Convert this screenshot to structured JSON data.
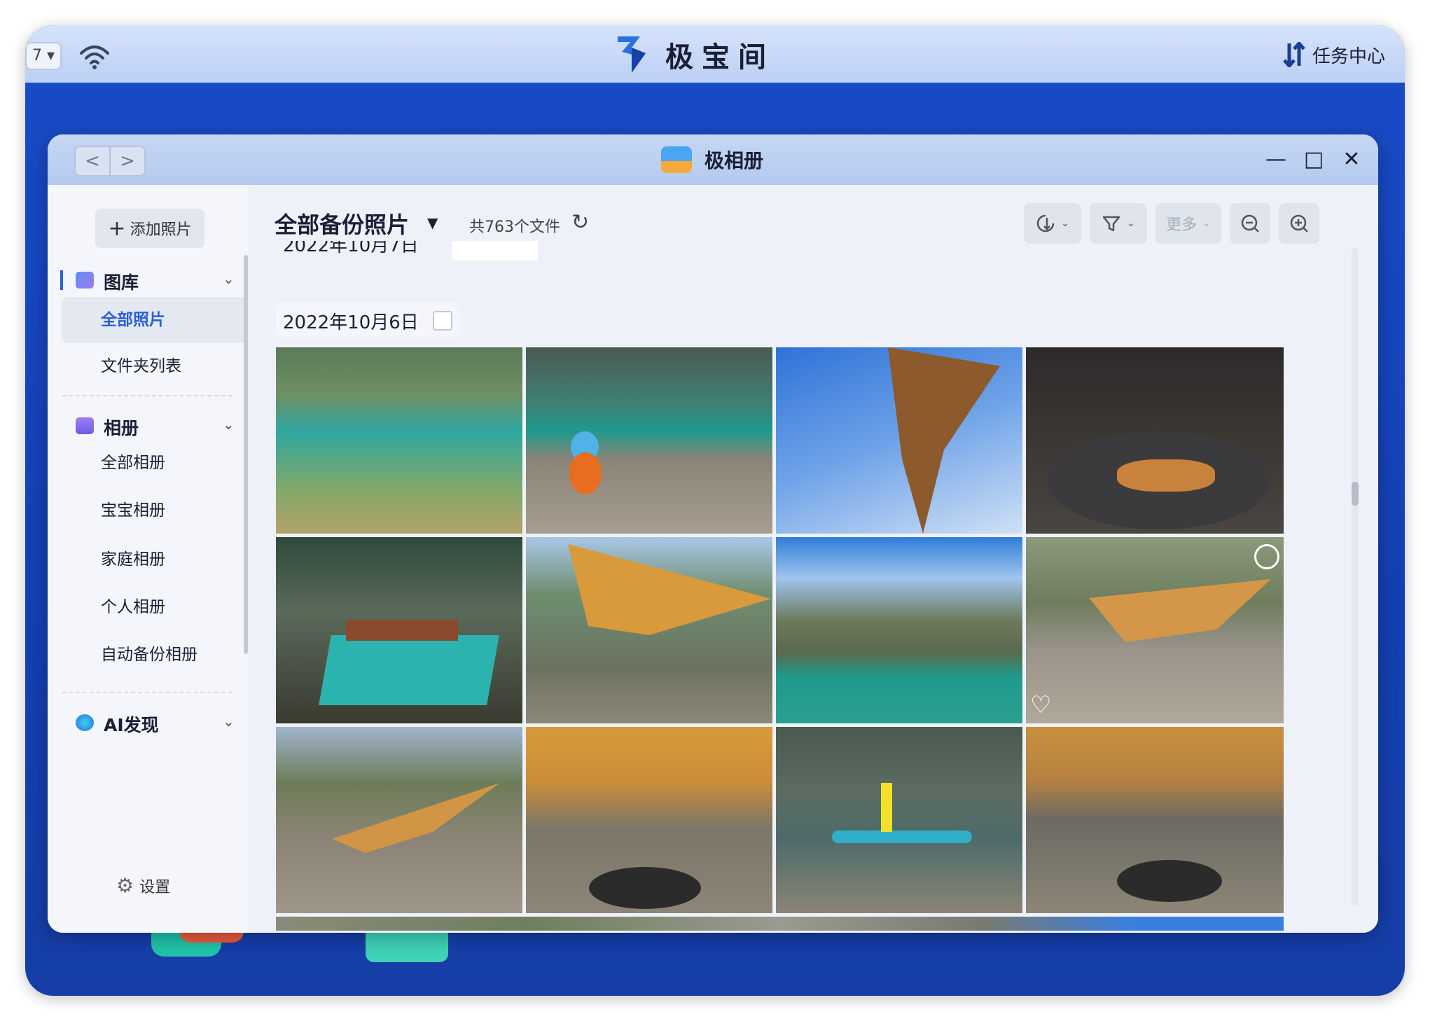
{
  "topbar": {
    "window_btn_label": "7 ▾",
    "brand": "极宝间",
    "task_center": "任务中心"
  },
  "window": {
    "title": "极相册",
    "nav_back": "<",
    "nav_forward": ">",
    "minimize": "—",
    "maximize": "□",
    "close": "✕"
  },
  "sidebar": {
    "add_photo": "添加照片",
    "sections": [
      {
        "label": "图库",
        "items": [
          "全部照片",
          "文件夹列表"
        ]
      },
      {
        "label": "相册",
        "items": [
          "全部相册",
          "宝宝相册",
          "家庭相册",
          "个人相册",
          "自动备份相册"
        ]
      },
      {
        "label": "AI发现",
        "items": []
      }
    ],
    "active_item": "全部照片",
    "settings": "设置"
  },
  "main": {
    "title": "全部备份照片",
    "count": "共763个文件",
    "toolbar": {
      "sort_icon": "sort-icon",
      "filter_icon": "filter-icon",
      "more": "更多",
      "zoom_out_icon": "zoom-out-icon",
      "zoom_in_icon": "zoom-in-icon"
    },
    "previous_date_partial": "2022年10月7日",
    "date_group": "2022年10月6日",
    "photos": [
      {
        "name": "river-clear-water"
      },
      {
        "name": "squirtle-toy-by-river"
      },
      {
        "name": "tent-canopy-sky"
      },
      {
        "name": "steak-on-grill-pan"
      },
      {
        "name": "bbq-skewers-grill"
      },
      {
        "name": "camp-under-tarp-mountains"
      },
      {
        "name": "green-lake-cliffs"
      },
      {
        "name": "tarp-camp-gravel",
        "selectable": true,
        "favorite": true
      },
      {
        "name": "tarp-camp-wide"
      },
      {
        "name": "people-under-tarp"
      },
      {
        "name": "paddleboard-on-lake"
      },
      {
        "name": "grill-under-tarp"
      }
    ]
  },
  "colors": {
    "accent": "#2b5fd9",
    "desktop_bg": "#1a4cc9"
  }
}
